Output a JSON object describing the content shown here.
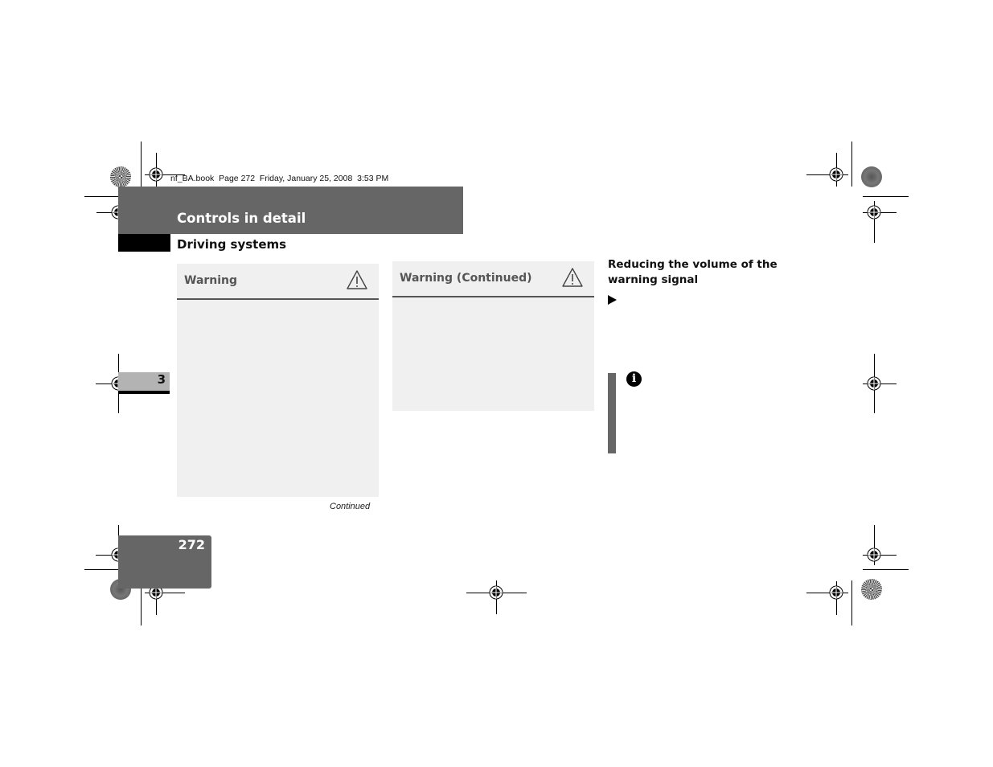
{
  "print_info": "nf_BA.book  Page 272  Friday, January 25, 2008  3:53 PM",
  "header": {
    "title": "Controls in detail",
    "subtitle": "Driving systems"
  },
  "chapter_tab": {
    "number": "3"
  },
  "warnings": [
    {
      "label": "Warning",
      "icon": "warning-triangle-icon"
    },
    {
      "label": "Warning (Continued)",
      "icon": "warning-triangle-icon"
    }
  ],
  "continued_label": "Continued",
  "right_column": {
    "heading": "Reducing the volume of the warning signal",
    "step_icon": "arrow-right-icon",
    "note_icon": "info-icon",
    "note_icon_glyph": "i"
  },
  "page_number": "272",
  "colors": {
    "header_gray": "#666666",
    "warning_bg": "#f0f0f0",
    "chapter_tab_gray": "#b3b3b3"
  }
}
